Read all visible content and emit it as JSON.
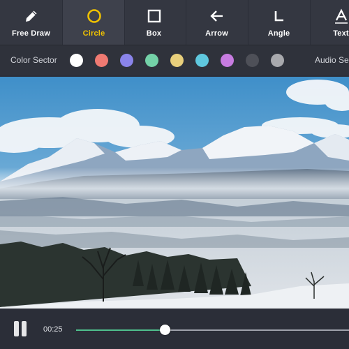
{
  "toolbar": {
    "tools": [
      {
        "label": "Free Draw",
        "icon": "pencil-icon",
        "active": false
      },
      {
        "label": "Circle",
        "icon": "circle-icon",
        "active": true
      },
      {
        "label": "Box",
        "icon": "square-icon",
        "active": false
      },
      {
        "label": "Arrow",
        "icon": "arrow-left-icon",
        "active": false
      },
      {
        "label": "Angle",
        "icon": "angle-icon",
        "active": false
      },
      {
        "label": "Text",
        "icon": "text-icon",
        "active": false
      }
    ],
    "active_color": "#f0c200"
  },
  "color_bar": {
    "label": "Color Sector",
    "colors": [
      "#ffffff",
      "#f07a72",
      "#8a84ea",
      "#74d2a8",
      "#e8cf7c",
      "#5fc8de",
      "#c77ce0",
      "#4e5058",
      "#a8a9ad"
    ],
    "audio_label": "Audio Se"
  },
  "video": {
    "scene": "snowy-mountain-landscape"
  },
  "player": {
    "state": "playing",
    "control_icon": "pause-icon",
    "time": "00:25",
    "progress": 0.326,
    "progress_color": "#4fc08d"
  }
}
